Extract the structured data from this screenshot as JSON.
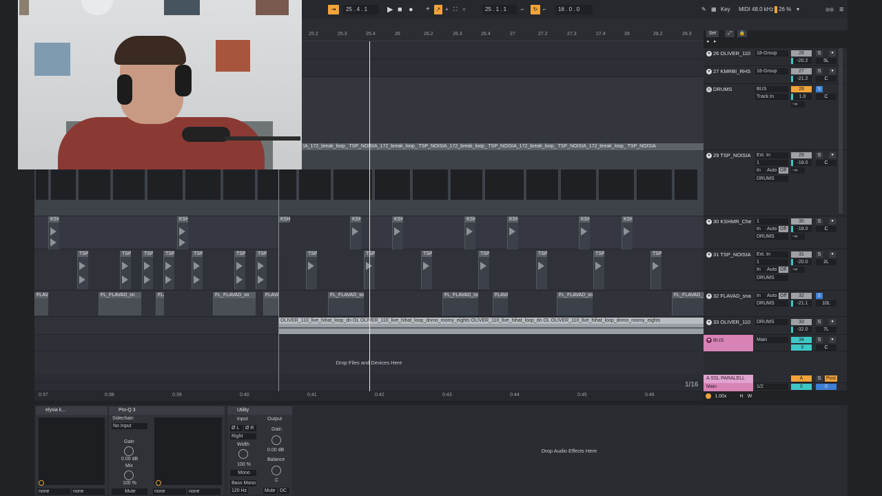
{
  "transport": {
    "position": "25 . 4 . 1",
    "loop_start": "25 . 1 . 1",
    "loop_length": "16 . 0 . 0",
    "key_label": "Key",
    "midi_label": "MIDI",
    "sample_rate": "48.0 kHz",
    "cpu": "26 %"
  },
  "ruler": {
    "labels": [
      "25.2",
      "25.3",
      "25.4",
      "26",
      "26.2",
      "26.3",
      "26.4",
      "27",
      "27.2",
      "27.3",
      "27.4",
      "28",
      "28.2",
      "28.3"
    ],
    "set_label": "Set"
  },
  "arrangement": {
    "drop_text": "Drop Files and Devices Here",
    "zoom_label": "1/16",
    "timeline_labels": [
      "0:37",
      "0:38",
      "0:39",
      "0:40",
      "0:41",
      "0:42",
      "0:43",
      "0:44",
      "0:45",
      "0:46"
    ],
    "break_clip_label": "IA_172_break_loop_ TSP_NOISIA_172_break_loop_ TSP_NOISIA_172_break_loop_ TSP_NOISIA_172_break_loop_ TSP_NOISIA_172_break_loop_ TSP_NOISIA",
    "hihat_clip_label": "OLIVER_110_live_hihat_loop_dn OL OLIVER_110_live_hihat_loop_dnmo_roomy_eights          OLIVER_110_live_hihat_loop_dn OL OLIVER_110_live_hihat_loop_dnmo_roomy_eights",
    "ksh_label": "KSH",
    "tsp_label": "TSP",
    "flava_label": "FLAVA",
    "flavad_label": "FL_FLAVAD_sna",
    "flavad_short": "FL_FLAVAD_sn"
  },
  "tracks": [
    {
      "name": "26 OLIVER_110",
      "input": "18-Group",
      "num": "26",
      "vol": "-20.2",
      "pan": "5L"
    },
    {
      "name": "27 KMRBI_RHS",
      "input": "18-Group",
      "num": "27",
      "vol": "-21.2",
      "pan": "C"
    },
    {
      "name": "DRUMS",
      "input": "BUS",
      "input2": "Track In",
      "num": "28",
      "vol": "1.0",
      "pan": "C",
      "minus_inf": "-∞"
    },
    {
      "name": "29 TSP_NOISIA",
      "input": "Ext. In",
      "input2": "1",
      "num": "29",
      "vol": "-18.0",
      "pan": "C",
      "out": "DRUMS",
      "in_label": "In",
      "auto_label": "Auto",
      "off_label": "Off",
      "minus_inf": "-∞"
    },
    {
      "name": "30 KSHMR_Che",
      "input": "1",
      "num": "30",
      "vol": "-18.0",
      "pan": "C",
      "out": "DRUMS",
      "in_label": "In",
      "auto_label": "Auto",
      "off_label": "Off",
      "minus_inf": "-∞"
    },
    {
      "name": "31 TSP_NOISIA",
      "input": "Ext. In",
      "input2": "1",
      "num": "31",
      "vol": "-20.0",
      "pan": "2L",
      "out": "DRUMS",
      "in_label": "In",
      "auto_label": "Auto",
      "off_label": "Off",
      "minus_inf": "-∞"
    },
    {
      "name": "32 FLAVAD_sna",
      "num": "32",
      "vol": "-21.1",
      "pan": "10L",
      "out": "DRUMS",
      "in_label": "In",
      "auto_label": "Auto",
      "off_label": "Off"
    },
    {
      "name": "33 OLIVER_110",
      "input": "DRUMS",
      "num": "33",
      "vol": "-32.0",
      "pan": "7L"
    },
    {
      "name": "BUS",
      "input": "Main",
      "num": "34",
      "vol": "0",
      "pan": "C"
    }
  ],
  "returns": {
    "ssl": "A SSL PARALELL",
    "ssl_letter": "A",
    "post_label": "Post",
    "main": "Main",
    "main_ratio": "1/2",
    "main_vol": "0",
    "main_pan": "0",
    "tempo_mult": "1.00x",
    "h_label": "H",
    "w_label": "W"
  },
  "devices": {
    "dev1_title": "elysia k...",
    "dev1_sel1": "none",
    "dev1_sel2": "none",
    "dev2_title": "Pro-Q 3",
    "sidechain_label": "Sidechain",
    "no_input": "No Input",
    "gain_label": "Gain",
    "gain_val": "0.00 dB",
    "mix_label": "Mix",
    "mix_val": "100 %",
    "mute_label": "Mute",
    "dev2_sel1": "none",
    "dev2_sel2": "none",
    "utility_title": "Utility",
    "input_label": "Input",
    "output_label": "Output",
    "phase_l": "Ø L",
    "phase_r": "Ø R",
    "channel_sel": "Right",
    "width_label": "Width",
    "width_val": "100 %",
    "mono_label": "Mono",
    "bass_mono_label": "Bass Mono",
    "bass_freq": "120 Hz",
    "out_gain_label": "Gain",
    "out_gain_val": "0.00 dB",
    "balance_label": "Balance",
    "balance_val": "C",
    "util_mute": "Mute",
    "util_dc": "DC",
    "drop_fx_text": "Drop Audio Effects Here"
  }
}
